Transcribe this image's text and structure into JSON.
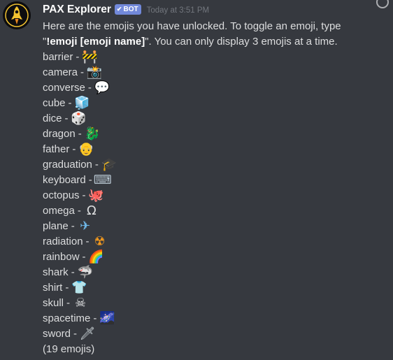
{
  "message": {
    "username": "PAX Explorer",
    "bot_badge": "BOT",
    "timestamp": "Today at 3:51 PM",
    "intro": {
      "part1": "Here are the emojis you have unlocked. To toggle an emoji, type \"",
      "bold": "!emoji [emoji name]",
      "part2": "\". You can only display 3 emojis at a time."
    },
    "emojis": [
      {
        "name": "barrier",
        "sep": "-",
        "glyph": "🚧",
        "icon": "construction-barrier-icon",
        "color": "#e8a317"
      },
      {
        "name": "camera",
        "sep": "-",
        "glyph": "📸",
        "icon": "camera-flash-icon",
        "color": "#5a6f87"
      },
      {
        "name": "converse",
        "sep": "-",
        "glyph": "💬",
        "icon": "speech-balloon-icon",
        "color": "#8ecdf4"
      },
      {
        "name": "cube",
        "sep": "-",
        "glyph": "🧊",
        "icon": "ice-cube-icon",
        "color": "#a9d9f5"
      },
      {
        "name": "dice",
        "sep": "-",
        "glyph": "🎲",
        "icon": "game-die-icon",
        "color": "#d8263b"
      },
      {
        "name": "dragon",
        "sep": "-",
        "glyph": "🐉",
        "icon": "dragon-icon",
        "color": "#4da845"
      },
      {
        "name": "father",
        "sep": "-",
        "glyph": "👴",
        "icon": "old-man-icon",
        "color": "#f2cf8f"
      },
      {
        "name": "graduation",
        "sep": "-",
        "glyph": "🎓",
        "icon": "graduation-cap-icon",
        "color": "#2b2f33"
      },
      {
        "name": "keyboard",
        "sep": "-",
        "glyph": "⌨",
        "icon": "keyboard-icon",
        "color": "#b4c2cc"
      },
      {
        "name": "octopus",
        "sep": "-",
        "glyph": "🐙",
        "icon": "octopus-icon",
        "color": "#a35fbd"
      },
      {
        "name": "omega",
        "sep": "-",
        "glyph": "Ω",
        "icon": "omega-icon",
        "color": "#dcddde"
      },
      {
        "name": "plane",
        "sep": "-",
        "glyph": "✈",
        "icon": "airplane-icon",
        "color": "#6fb8e8"
      },
      {
        "name": "radiation",
        "sep": "-",
        "glyph": "☢",
        "icon": "radioactive-icon",
        "color": "#f59a1d"
      },
      {
        "name": "rainbow",
        "sep": "-",
        "glyph": "🌈",
        "icon": "rainbow-icon",
        "color": "#e8473e"
      },
      {
        "name": "shark",
        "sep": "-",
        "glyph": "🦈",
        "icon": "shark-icon",
        "color": "#7b8d99"
      },
      {
        "name": "shirt",
        "sep": "-",
        "glyph": "👕",
        "icon": "t-shirt-icon",
        "color": "#3b88c3"
      },
      {
        "name": "skull",
        "sep": "-",
        "glyph": "☠",
        "icon": "skull-crossbones-icon",
        "color": "#e6e7e8"
      },
      {
        "name": "spacetime",
        "sep": "-",
        "glyph": "🌌",
        "icon": "milky-way-icon",
        "color": "#5b3a9e"
      },
      {
        "name": "sword",
        "sep": "-",
        "glyph": "🗡",
        "icon": "dagger-icon",
        "color": "#cfd8dc"
      }
    ],
    "footer": "(19 emojis)"
  },
  "colors": {
    "background": "#36393f",
    "text": "#dcddde",
    "username": "#ffffff",
    "badge": "#7289da",
    "timestamp": "#72767d"
  }
}
